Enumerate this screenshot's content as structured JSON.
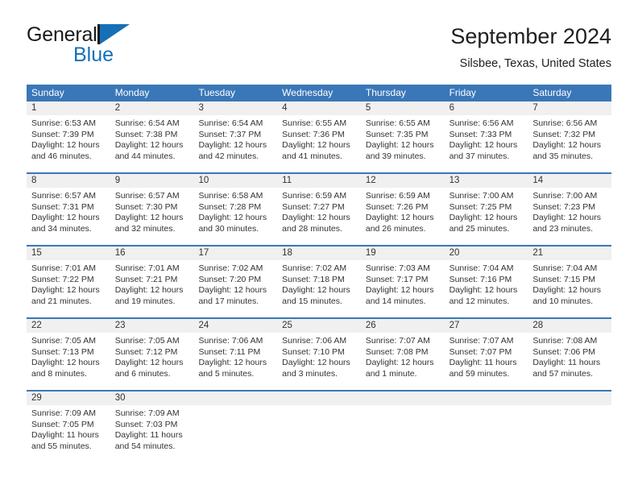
{
  "brand": {
    "name_dark": "General",
    "name_blue": "Blue",
    "flag_icon": "flag-triangle-icon"
  },
  "header": {
    "title": "September 2024",
    "subtitle": "Silsbee, Texas, United States"
  },
  "colors": {
    "header_blue": "#3a77b8",
    "brand_blue": "#1570b8",
    "day_band_gray": "#f0f0f0",
    "text": "#333333"
  },
  "weekdays": [
    "Sunday",
    "Monday",
    "Tuesday",
    "Wednesday",
    "Thursday",
    "Friday",
    "Saturday"
  ],
  "weeks": [
    [
      {
        "day": "1",
        "sunrise": "Sunrise: 6:53 AM",
        "sunset": "Sunset: 7:39 PM",
        "daylight1": "Daylight: 12 hours",
        "daylight2": "and 46 minutes."
      },
      {
        "day": "2",
        "sunrise": "Sunrise: 6:54 AM",
        "sunset": "Sunset: 7:38 PM",
        "daylight1": "Daylight: 12 hours",
        "daylight2": "and 44 minutes."
      },
      {
        "day": "3",
        "sunrise": "Sunrise: 6:54 AM",
        "sunset": "Sunset: 7:37 PM",
        "daylight1": "Daylight: 12 hours",
        "daylight2": "and 42 minutes."
      },
      {
        "day": "4",
        "sunrise": "Sunrise: 6:55 AM",
        "sunset": "Sunset: 7:36 PM",
        "daylight1": "Daylight: 12 hours",
        "daylight2": "and 41 minutes."
      },
      {
        "day": "5",
        "sunrise": "Sunrise: 6:55 AM",
        "sunset": "Sunset: 7:35 PM",
        "daylight1": "Daylight: 12 hours",
        "daylight2": "and 39 minutes."
      },
      {
        "day": "6",
        "sunrise": "Sunrise: 6:56 AM",
        "sunset": "Sunset: 7:33 PM",
        "daylight1": "Daylight: 12 hours",
        "daylight2": "and 37 minutes."
      },
      {
        "day": "7",
        "sunrise": "Sunrise: 6:56 AM",
        "sunset": "Sunset: 7:32 PM",
        "daylight1": "Daylight: 12 hours",
        "daylight2": "and 35 minutes."
      }
    ],
    [
      {
        "day": "8",
        "sunrise": "Sunrise: 6:57 AM",
        "sunset": "Sunset: 7:31 PM",
        "daylight1": "Daylight: 12 hours",
        "daylight2": "and 34 minutes."
      },
      {
        "day": "9",
        "sunrise": "Sunrise: 6:57 AM",
        "sunset": "Sunset: 7:30 PM",
        "daylight1": "Daylight: 12 hours",
        "daylight2": "and 32 minutes."
      },
      {
        "day": "10",
        "sunrise": "Sunrise: 6:58 AM",
        "sunset": "Sunset: 7:28 PM",
        "daylight1": "Daylight: 12 hours",
        "daylight2": "and 30 minutes."
      },
      {
        "day": "11",
        "sunrise": "Sunrise: 6:59 AM",
        "sunset": "Sunset: 7:27 PM",
        "daylight1": "Daylight: 12 hours",
        "daylight2": "and 28 minutes."
      },
      {
        "day": "12",
        "sunrise": "Sunrise: 6:59 AM",
        "sunset": "Sunset: 7:26 PM",
        "daylight1": "Daylight: 12 hours",
        "daylight2": "and 26 minutes."
      },
      {
        "day": "13",
        "sunrise": "Sunrise: 7:00 AM",
        "sunset": "Sunset: 7:25 PM",
        "daylight1": "Daylight: 12 hours",
        "daylight2": "and 25 minutes."
      },
      {
        "day": "14",
        "sunrise": "Sunrise: 7:00 AM",
        "sunset": "Sunset: 7:23 PM",
        "daylight1": "Daylight: 12 hours",
        "daylight2": "and 23 minutes."
      }
    ],
    [
      {
        "day": "15",
        "sunrise": "Sunrise: 7:01 AM",
        "sunset": "Sunset: 7:22 PM",
        "daylight1": "Daylight: 12 hours",
        "daylight2": "and 21 minutes."
      },
      {
        "day": "16",
        "sunrise": "Sunrise: 7:01 AM",
        "sunset": "Sunset: 7:21 PM",
        "daylight1": "Daylight: 12 hours",
        "daylight2": "and 19 minutes."
      },
      {
        "day": "17",
        "sunrise": "Sunrise: 7:02 AM",
        "sunset": "Sunset: 7:20 PM",
        "daylight1": "Daylight: 12 hours",
        "daylight2": "and 17 minutes."
      },
      {
        "day": "18",
        "sunrise": "Sunrise: 7:02 AM",
        "sunset": "Sunset: 7:18 PM",
        "daylight1": "Daylight: 12 hours",
        "daylight2": "and 15 minutes."
      },
      {
        "day": "19",
        "sunrise": "Sunrise: 7:03 AM",
        "sunset": "Sunset: 7:17 PM",
        "daylight1": "Daylight: 12 hours",
        "daylight2": "and 14 minutes."
      },
      {
        "day": "20",
        "sunrise": "Sunrise: 7:04 AM",
        "sunset": "Sunset: 7:16 PM",
        "daylight1": "Daylight: 12 hours",
        "daylight2": "and 12 minutes."
      },
      {
        "day": "21",
        "sunrise": "Sunrise: 7:04 AM",
        "sunset": "Sunset: 7:15 PM",
        "daylight1": "Daylight: 12 hours",
        "daylight2": "and 10 minutes."
      }
    ],
    [
      {
        "day": "22",
        "sunrise": "Sunrise: 7:05 AM",
        "sunset": "Sunset: 7:13 PM",
        "daylight1": "Daylight: 12 hours",
        "daylight2": "and 8 minutes."
      },
      {
        "day": "23",
        "sunrise": "Sunrise: 7:05 AM",
        "sunset": "Sunset: 7:12 PM",
        "daylight1": "Daylight: 12 hours",
        "daylight2": "and 6 minutes."
      },
      {
        "day": "24",
        "sunrise": "Sunrise: 7:06 AM",
        "sunset": "Sunset: 7:11 PM",
        "daylight1": "Daylight: 12 hours",
        "daylight2": "and 5 minutes."
      },
      {
        "day": "25",
        "sunrise": "Sunrise: 7:06 AM",
        "sunset": "Sunset: 7:10 PM",
        "daylight1": "Daylight: 12 hours",
        "daylight2": "and 3 minutes."
      },
      {
        "day": "26",
        "sunrise": "Sunrise: 7:07 AM",
        "sunset": "Sunset: 7:08 PM",
        "daylight1": "Daylight: 12 hours",
        "daylight2": "and 1 minute."
      },
      {
        "day": "27",
        "sunrise": "Sunrise: 7:07 AM",
        "sunset": "Sunset: 7:07 PM",
        "daylight1": "Daylight: 11 hours",
        "daylight2": "and 59 minutes."
      },
      {
        "day": "28",
        "sunrise": "Sunrise: 7:08 AM",
        "sunset": "Sunset: 7:06 PM",
        "daylight1": "Daylight: 11 hours",
        "daylight2": "and 57 minutes."
      }
    ],
    [
      {
        "day": "29",
        "sunrise": "Sunrise: 7:09 AM",
        "sunset": "Sunset: 7:05 PM",
        "daylight1": "Daylight: 11 hours",
        "daylight2": "and 55 minutes."
      },
      {
        "day": "30",
        "sunrise": "Sunrise: 7:09 AM",
        "sunset": "Sunset: 7:03 PM",
        "daylight1": "Daylight: 11 hours",
        "daylight2": "and 54 minutes."
      },
      {
        "day": "",
        "sunrise": "",
        "sunset": "",
        "daylight1": "",
        "daylight2": ""
      },
      {
        "day": "",
        "sunrise": "",
        "sunset": "",
        "daylight1": "",
        "daylight2": ""
      },
      {
        "day": "",
        "sunrise": "",
        "sunset": "",
        "daylight1": "",
        "daylight2": ""
      },
      {
        "day": "",
        "sunrise": "",
        "sunset": "",
        "daylight1": "",
        "daylight2": ""
      },
      {
        "day": "",
        "sunrise": "",
        "sunset": "",
        "daylight1": "",
        "daylight2": ""
      }
    ]
  ]
}
